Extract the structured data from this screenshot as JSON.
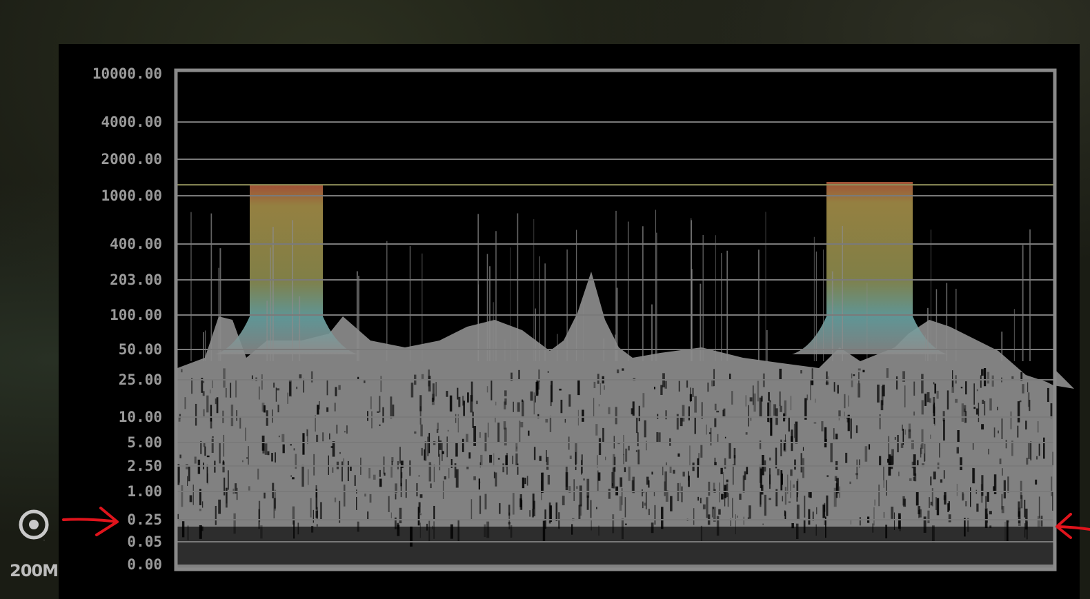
{
  "scope": {
    "y_ticks": [
      {
        "value": 10000,
        "label": "10000.00"
      },
      {
        "value": 4000,
        "label": "4000.00"
      },
      {
        "value": 2000,
        "label": "2000.00"
      },
      {
        "value": 1000,
        "label": "1000.00"
      },
      {
        "value": 400,
        "label": "400.00"
      },
      {
        "value": 203,
        "label": "203.00"
      },
      {
        "value": 100,
        "label": "100.00"
      },
      {
        "value": 50,
        "label": "50.00"
      },
      {
        "value": 25,
        "label": "25.00"
      },
      {
        "value": 10,
        "label": "10.00"
      },
      {
        "value": 5,
        "label": "5.00"
      },
      {
        "value": 2.5,
        "label": "2.50"
      },
      {
        "value": 1,
        "label": "1.00"
      },
      {
        "value": 0.25,
        "label": "0.25"
      },
      {
        "value": 0.05,
        "label": "0.05"
      },
      {
        "value": 0,
        "label": "0.00"
      }
    ],
    "peak_line_nits": 1300,
    "colors": {
      "grid": "#7a7a7a",
      "frame": "#8a8a8a",
      "trace": "#8c8c8c",
      "peak_line": "#8f8f5a",
      "highlight_yellow": "#a3a04a",
      "highlight_cyan": "#6aa6a6",
      "highlight_red": "#b0503a"
    }
  },
  "annotations": {
    "arrow_color": "#e0141c",
    "marked_level": "0.25"
  },
  "map": {
    "zoom_label": "200M",
    "icon": "target-icon"
  }
}
